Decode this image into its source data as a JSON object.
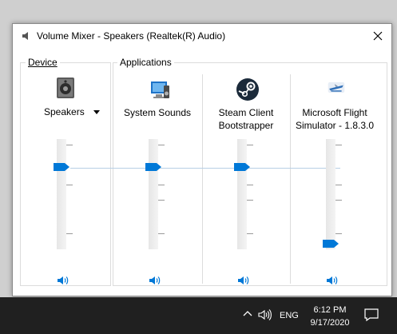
{
  "window": {
    "title": "Volume Mixer - Speakers (Realtek(R) Audio)"
  },
  "groups": {
    "device_label": "Device",
    "applications_label": "Applications"
  },
  "device": {
    "name": "Speakers",
    "volume_percent": 75
  },
  "applications": [
    {
      "name": "System Sounds",
      "icon": "system-sounds-icon",
      "volume_percent": 75
    },
    {
      "name": "Steam Client Bootstrapper",
      "line1": "Steam Client",
      "line2": "Bootstrapper",
      "icon": "steam-icon",
      "volume_percent": 75
    },
    {
      "name": "Microsoft Flight Simulator - 1.8.3.0",
      "line1": "Microsoft Flight",
      "line2": "Simulator - 1.8.3.0",
      "icon": "flight-simulator-icon",
      "volume_percent": 5
    }
  ],
  "taskbar": {
    "language": "ENG",
    "time": "6:12 PM",
    "date": "9/17/2020"
  },
  "colors": {
    "accent": "#0078d7",
    "link_line": "#b7cfe4",
    "taskbar": "#202020"
  }
}
